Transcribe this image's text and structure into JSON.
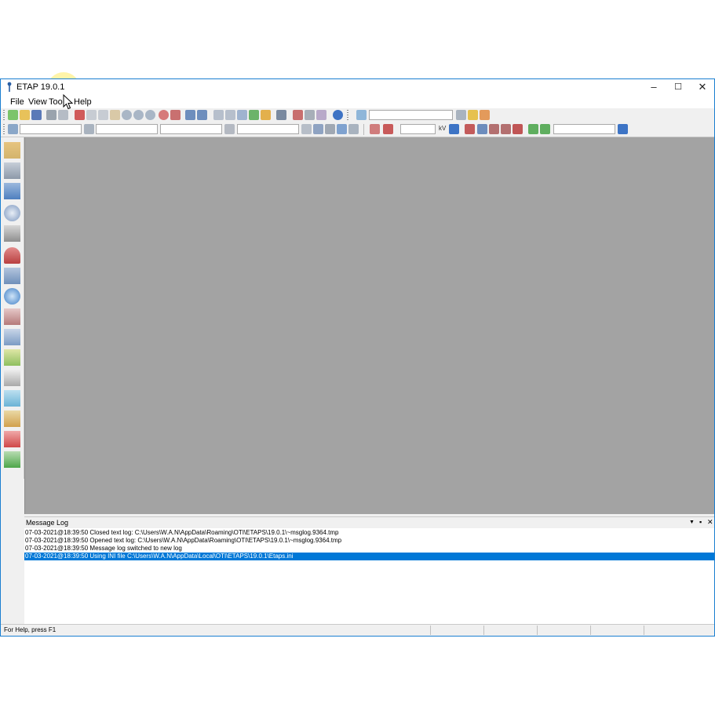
{
  "window": {
    "title": "ETAP 19.0.1",
    "controls": {
      "minimize": "–",
      "maximize": "☐",
      "close": "✕"
    }
  },
  "menu": [
    "File",
    "View",
    "Tools",
    "Help"
  ],
  "toolbar2": {
    "kv_label": "kV"
  },
  "message_log": {
    "title": "Message Log",
    "controls": {
      "dropdown": "▼",
      "pin": "▪",
      "close": "✕"
    },
    "lines": [
      {
        "text": "07-03-2021@18:39:50 Closed text log: C:\\Users\\W.A.N\\AppData\\Roaming\\OTI\\ETAPS\\19.0.1\\~msglog.9364.tmp",
        "selected": false
      },
      {
        "text": "07-03-2021@18:39:50 Opened text log: C:\\Users\\W.A.N\\AppData\\Roaming\\OTI\\ETAPS\\19.0.1\\~msglog.9364.tmp",
        "selected": false
      },
      {
        "text": "07-03-2021@18:39:50 Message log switched to new log",
        "selected": false
      },
      {
        "text": "07-03-2021@18:39:50 Using INI file C:\\Users\\W.A.N\\AppData\\Local\\OTI\\ETAPS\\19.0.1\\Etaps.ini",
        "selected": true
      }
    ]
  },
  "status_bar": {
    "text": "For Help, press F1"
  },
  "colors": {
    "canvas": "#a3a3a3",
    "selection": "#0078d7",
    "window_border": "#1a7fd1"
  }
}
